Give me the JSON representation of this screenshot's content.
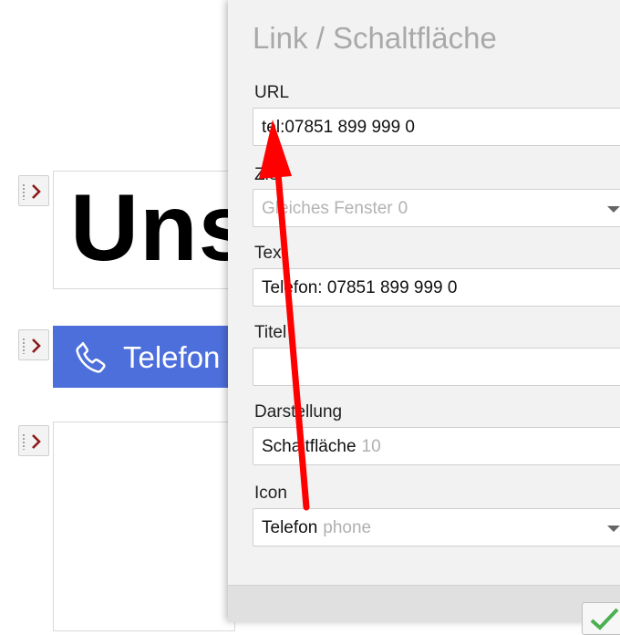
{
  "editor": {
    "heading_text": "Uns",
    "phone_button_label": "Telefon"
  },
  "dialog": {
    "title": "Link / Schaltfläche",
    "fields": {
      "url": {
        "label": "URL",
        "value": "tel:07851 899 999 0"
      },
      "ziel": {
        "label": "Ziel",
        "value": "Gleiches Fenster",
        "hint": "0"
      },
      "text": {
        "label": "Text",
        "value": "Telefon: 07851 899 999 0"
      },
      "titel": {
        "label": "Titel",
        "value": ""
      },
      "darstellung": {
        "label": "Darstellung",
        "value": "Schaltfläche",
        "hint": "10"
      },
      "icon": {
        "label": "Icon",
        "value": "Telefon",
        "hint": "phone"
      }
    }
  },
  "icons": {
    "handle": "chevron-right-icon",
    "phone": "phone-icon",
    "ok": "check-icon"
  },
  "colors": {
    "button_blue": "#4d6fdb",
    "chevron": "#8b1a1a",
    "arrow": "#ff0000",
    "check": "#4caf50"
  }
}
